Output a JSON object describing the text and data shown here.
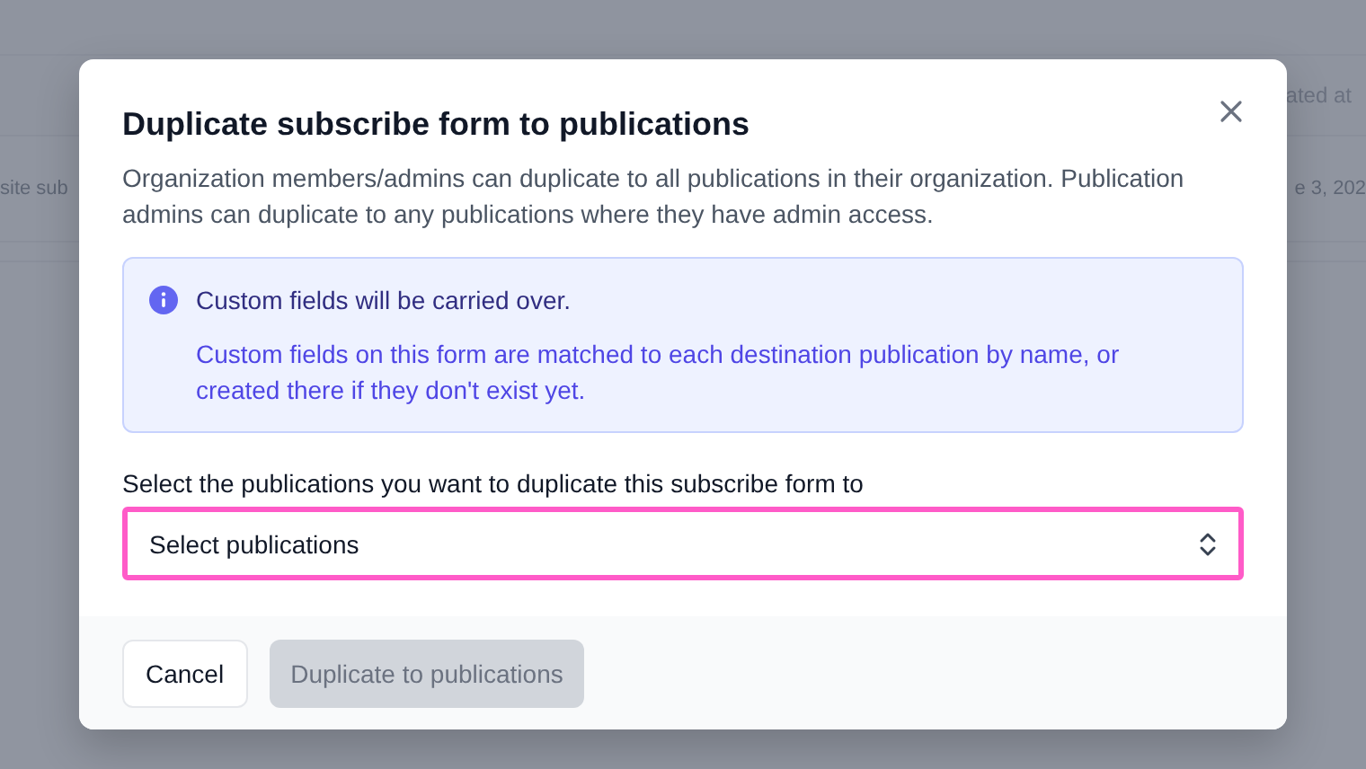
{
  "background": {
    "header_cell": "ated at",
    "row_cells": [
      "site sub",
      "e 3, 202"
    ]
  },
  "dialog": {
    "title": "Duplicate subscribe form to publications",
    "description": "Organization members/admins can duplicate to all publications in their organization. Publication admins can duplicate to any publications where they have admin access.",
    "notice": {
      "title": "Custom fields will be carried over.",
      "body": "Custom fields on this form are matched to each destination publication by name, or created there if they don't exist yet."
    },
    "select": {
      "label": "Select the publications you want to duplicate this subscribe form to",
      "placeholder": "Select publications",
      "focused": true
    },
    "buttons": [
      {
        "label": "Cancel",
        "kind": "secondary",
        "disabled": false
      },
      {
        "label": "Duplicate to publications",
        "kind": "primary",
        "disabled": true
      }
    ]
  }
}
